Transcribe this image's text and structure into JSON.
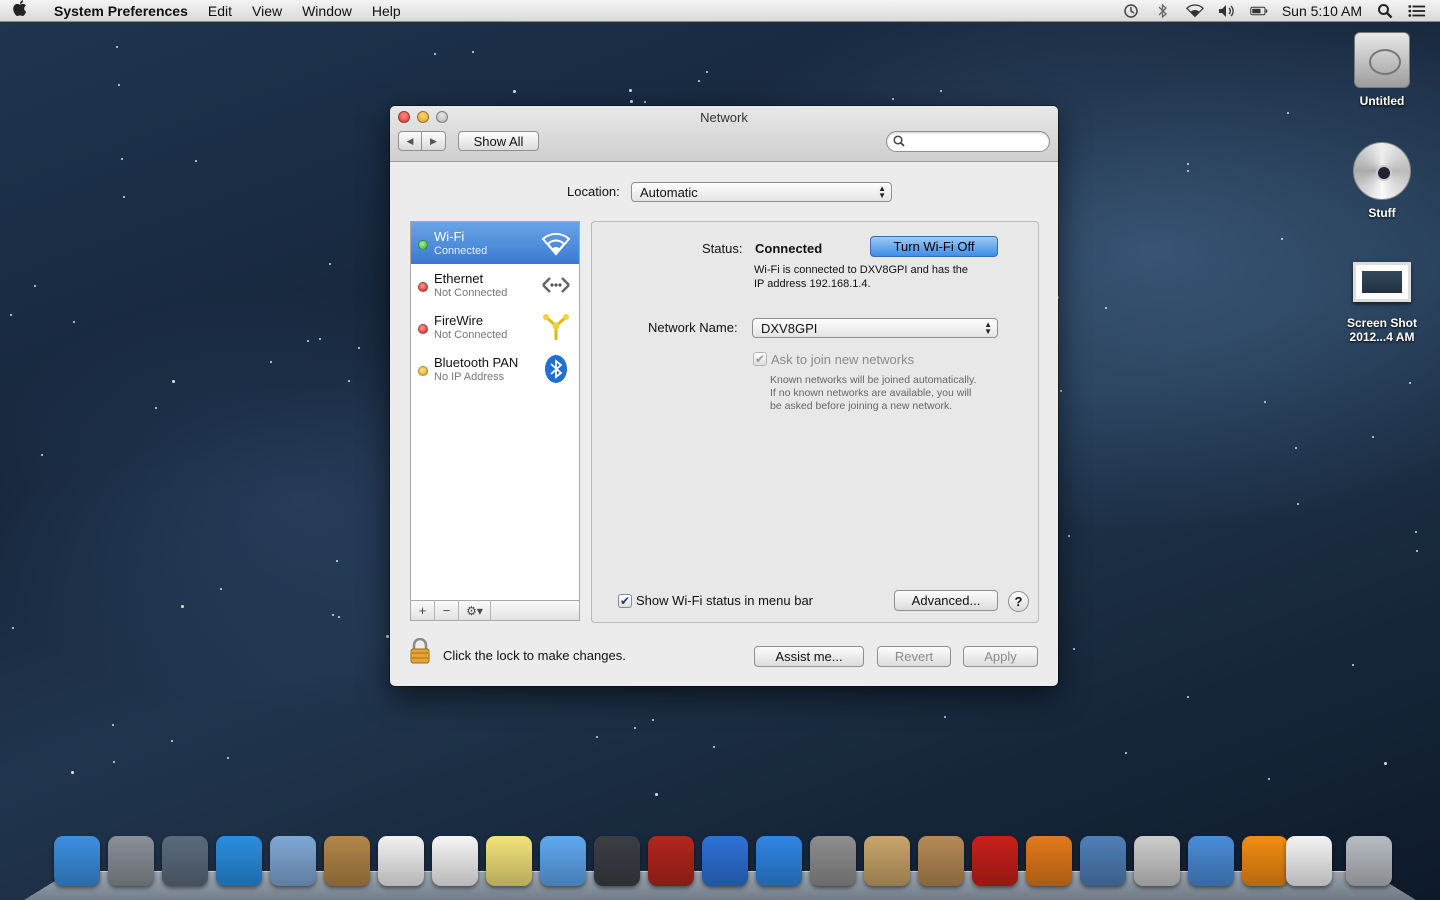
{
  "menubar": {
    "app_name": "System Preferences",
    "menus": [
      "Edit",
      "View",
      "Window",
      "Help"
    ],
    "clock": "Sun 5:10 AM"
  },
  "desktop": {
    "icons": [
      {
        "label": "Untitled",
        "icon": "hard-drive-icon"
      },
      {
        "label": "Stuff",
        "icon": "cd-disc-icon"
      },
      {
        "label_line1": "Screen Shot",
        "label_line2": "2012...4 AM",
        "icon": "screenshot-file-icon"
      }
    ]
  },
  "window": {
    "title": "Network",
    "show_all_label": "Show All",
    "search_placeholder": ""
  },
  "location": {
    "label": "Location:",
    "value": "Automatic"
  },
  "services": [
    {
      "name": "Wi-Fi",
      "status": "Connected",
      "dot": "green",
      "icon": "wifi-icon",
      "selected": true
    },
    {
      "name": "Ethernet",
      "status": "Not Connected",
      "dot": "red",
      "icon": "ethernet-icon",
      "selected": false
    },
    {
      "name": "FireWire",
      "status": "Not Connected",
      "dot": "red",
      "icon": "firewire-icon",
      "selected": false
    },
    {
      "name": "Bluetooth PAN",
      "status": "No IP Address",
      "dot": "yellow",
      "icon": "bluetooth-icon",
      "selected": false
    }
  ],
  "sidebar_tools": {
    "add": "+",
    "remove": "−",
    "gear": "⚙▾"
  },
  "detail": {
    "status_label": "Status:",
    "status_value": "Connected",
    "turn_off_label": "Turn Wi-Fi Off",
    "status_desc_line1": "Wi-Fi is connected to DXV8GPI and has the",
    "status_desc_line2": "IP address 192.168.1.4.",
    "network_name_label": "Network Name:",
    "network_name_value": "DXV8GPI",
    "ask_join_label": "Ask to join new networks",
    "ask_join_desc_line1": "Known networks will be joined automatically.",
    "ask_join_desc_line2": "If no known networks are available, you will",
    "ask_join_desc_line3": "be asked before joining a new network.",
    "show_status_label": "Show Wi-Fi status in menu bar",
    "advanced_label": "Advanced...",
    "help_label": "?"
  },
  "footer": {
    "lock_label": "Click the lock to make changes.",
    "assist_label": "Assist me...",
    "revert_label": "Revert",
    "apply_label": "Apply"
  },
  "dock": {
    "items": [
      {
        "name": "finder",
        "color": "#3d8fe0"
      },
      {
        "name": "launchpad",
        "color": "#8a8f98"
      },
      {
        "name": "mission-control",
        "color": "#5b6b7c"
      },
      {
        "name": "safari",
        "color": "#2a8ee0"
      },
      {
        "name": "mail",
        "color": "#7fa8d6"
      },
      {
        "name": "contacts",
        "color": "#b38648"
      },
      {
        "name": "calendar",
        "color": "#f2f2f2"
      },
      {
        "name": "reminders",
        "color": "#f6f6f6"
      },
      {
        "name": "notes",
        "color": "#f3e37a"
      },
      {
        "name": "messages",
        "color": "#5ea9ef"
      },
      {
        "name": "facetime",
        "color": "#3b3f45"
      },
      {
        "name": "photo-booth",
        "color": "#b3261e"
      },
      {
        "name": "itunes",
        "color": "#2d72d8"
      },
      {
        "name": "app-store",
        "color": "#2f86e4"
      },
      {
        "name": "system-preferences",
        "color": "#8e8e8e"
      },
      {
        "name": "archive-utility",
        "color": "#c9a56b"
      },
      {
        "name": "compress",
        "color": "#b58a55"
      },
      {
        "name": "filezilla",
        "color": "#c8201b"
      },
      {
        "name": "firefox",
        "color": "#e27a1c"
      },
      {
        "name": "remote-desktop",
        "color": "#4f7fb8"
      },
      {
        "name": "disk-utility",
        "color": "#cccccc"
      },
      {
        "name": "automator",
        "color": "#4b8cd8"
      },
      {
        "name": "vlc",
        "color": "#f28c12"
      }
    ],
    "right_items": [
      {
        "name": "documents-stack",
        "color": "#f4f4f4"
      },
      {
        "name": "trash",
        "color": "#b7bcc2"
      }
    ]
  }
}
